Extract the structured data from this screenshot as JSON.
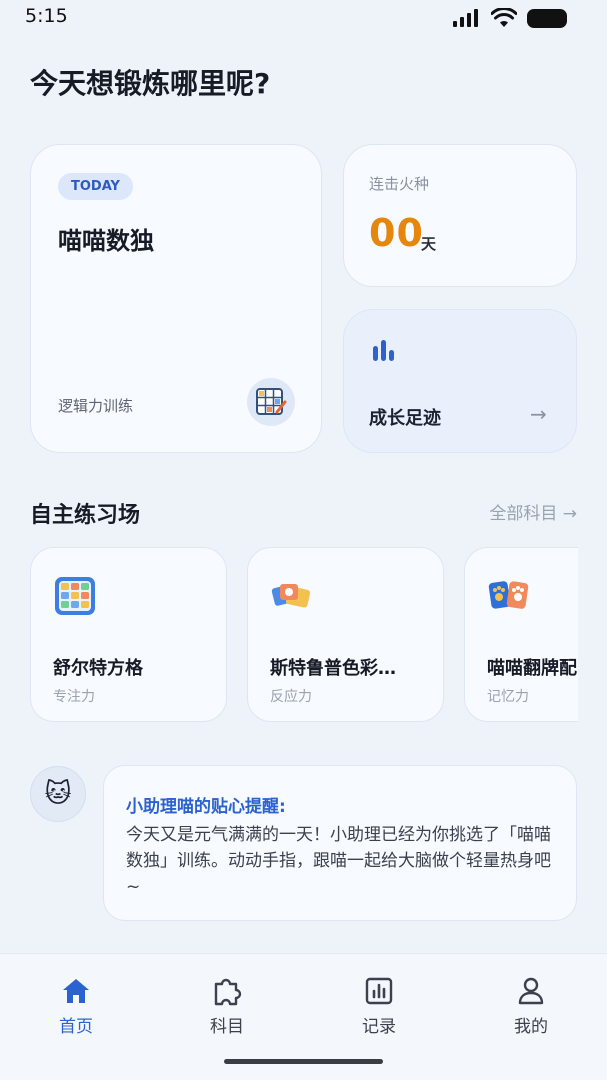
{
  "status": {
    "time": "5:15"
  },
  "page": {
    "title": "今天想锻炼哪里呢?"
  },
  "today": {
    "badge": "TODAY",
    "title": "喵喵数独",
    "subtitle": "逻辑力训练",
    "thumb_icon": "sudoku-puzzle-icon"
  },
  "streak": {
    "label": "连击火种",
    "value": "00",
    "unit": "天",
    "color": "#e4870c"
  },
  "growth": {
    "label": "成长足迹",
    "arrow": "→",
    "icon": "bar-chart-icon"
  },
  "practice": {
    "title": "自主练习场",
    "link": "全部科目 →",
    "subjects": [
      {
        "name": "舒尔特方格",
        "tag": "专注力",
        "icon": "schulte-grid-icon"
      },
      {
        "name": "斯特鲁普色彩…",
        "tag": "反应力",
        "icon": "color-cards-icon"
      },
      {
        "name": "喵喵翻牌配",
        "tag": "记忆力",
        "icon": "paw-cards-icon"
      }
    ]
  },
  "assistant": {
    "avatar": "🐱",
    "title": "小助理喵的贴心提醒:",
    "body": "今天又是元气满满的一天！小助理已经为你挑选了「喵喵数独」训练。动动手指，跟喵一起给大脑做个轻量热身吧~"
  },
  "tabbar": {
    "items": [
      {
        "label": "首页",
        "icon": "home-icon",
        "active": true
      },
      {
        "label": "科目",
        "icon": "puzzle-icon",
        "active": false
      },
      {
        "label": "记录",
        "icon": "chart-icon",
        "active": false
      },
      {
        "label": "我的",
        "icon": "user-icon",
        "active": false
      }
    ]
  },
  "colors": {
    "accent": "#2c62cf",
    "background": "#eef3f9",
    "streak": "#e4870c"
  }
}
